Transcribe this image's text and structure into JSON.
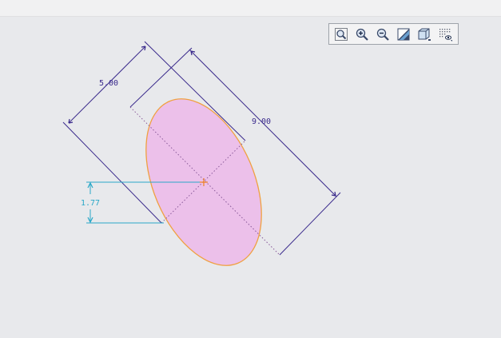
{
  "toolbar": {
    "buttons": [
      {
        "icon": "zoom-fit-icon"
      },
      {
        "icon": "zoom-in-icon"
      },
      {
        "icon": "zoom-out-icon"
      },
      {
        "icon": "repaint-icon"
      },
      {
        "icon": "display-style-icon"
      },
      {
        "icon": "grid-display-icon"
      }
    ]
  },
  "dimensions": {
    "minor_axis": "5.00",
    "major_axis": "9.00",
    "vertical_offset": "1.77"
  },
  "colors": {
    "ellipse_fill": "#ecc0ea",
    "ellipse_stroke": "#f0a040",
    "dimension": "#3a2a8c",
    "selected_dimension": "#2aa8c8",
    "center_marker": "#f08020",
    "background": "#e8e9ec"
  }
}
